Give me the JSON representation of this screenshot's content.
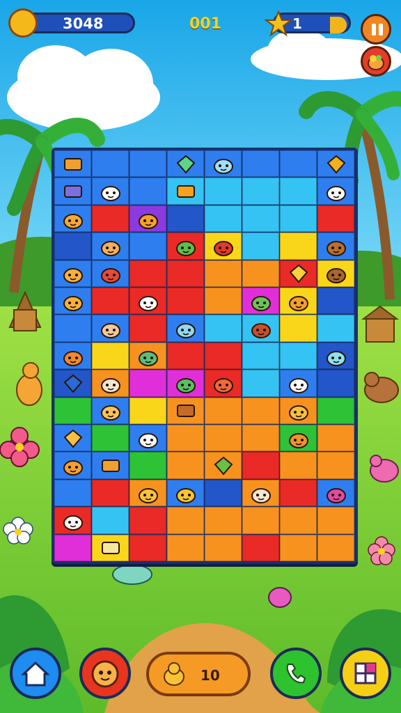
{
  "hud": {
    "coins": "3048",
    "level": "001",
    "lives": "1"
  },
  "bottom_bar": {
    "center_count": "10"
  },
  "board": {
    "rows": 15,
    "cols": 8,
    "cells": [
      [
        "blue",
        "blue",
        "blue",
        "blue",
        "blue",
        "blue",
        "blue",
        "blue"
      ],
      [
        "blue",
        "blue",
        "blue",
        "sky",
        "sky",
        "sky",
        "sky",
        "blue"
      ],
      [
        "blue",
        "red",
        "purple",
        "navy",
        "sky",
        "sky",
        "sky",
        "red"
      ],
      [
        "navy",
        "blue",
        "blue",
        "red",
        "yellow",
        "sky",
        "yellow",
        "blue"
      ],
      [
        "blue",
        "blue",
        "red",
        "red",
        "orange",
        "orange",
        "red",
        "yellow"
      ],
      [
        "blue",
        "red",
        "red",
        "red",
        "orange",
        "magenta",
        "yellow",
        "navy"
      ],
      [
        "blue",
        "blue",
        "red",
        "blue",
        "sky",
        "sky",
        "yellow",
        "sky"
      ],
      [
        "blue",
        "yellow",
        "orange",
        "red",
        "red",
        "sky",
        "sky",
        "navy"
      ],
      [
        "navy",
        "orange",
        "magenta",
        "magenta",
        "red",
        "sky",
        "blue",
        "navy"
      ],
      [
        "green",
        "blue",
        "yellow",
        "orange",
        "orange",
        "orange",
        "orange",
        "green"
      ],
      [
        "blue",
        "green",
        "blue",
        "orange",
        "orange",
        "orange",
        "green",
        "orange"
      ],
      [
        "blue",
        "blue",
        "green",
        "orange",
        "orange",
        "red",
        "orange",
        "orange"
      ],
      [
        "blue",
        "red",
        "orange",
        "blue",
        "navy",
        "orange",
        "red",
        "blue"
      ],
      [
        "red",
        "sky",
        "red",
        "orange",
        "orange",
        "orange",
        "orange",
        "orange"
      ],
      [
        "magenta",
        "yellow",
        "red",
        "orange",
        "orange",
        "red",
        "orange",
        "orange"
      ]
    ],
    "pieces": [
      {
        "r": 0,
        "c": 0,
        "kind": "block",
        "color": "#f0a030"
      },
      {
        "r": 0,
        "c": 3,
        "kind": "gem",
        "color": "#5cd68a"
      },
      {
        "r": 0,
        "c": 4,
        "kind": "creature",
        "color": "#9ee0ff"
      },
      {
        "r": 0,
        "c": 7,
        "kind": "gem",
        "color": "#f3b21b"
      },
      {
        "r": 1,
        "c": 0,
        "kind": "block",
        "color": "#7a6fe0"
      },
      {
        "r": 1,
        "c": 1,
        "kind": "creature",
        "color": "#ffffff"
      },
      {
        "r": 1,
        "c": 3,
        "kind": "block",
        "color": "#f6a21d"
      },
      {
        "r": 1,
        "c": 7,
        "kind": "creature",
        "color": "#ffffff"
      },
      {
        "r": 2,
        "c": 0,
        "kind": "creature",
        "color": "#f3a83a"
      },
      {
        "r": 2,
        "c": 2,
        "kind": "creature",
        "color": "#f5a02a"
      },
      {
        "r": 3,
        "c": 1,
        "kind": "creature",
        "color": "#f2b060"
      },
      {
        "r": 3,
        "c": 3,
        "kind": "creature",
        "color": "#5ac04a"
      },
      {
        "r": 3,
        "c": 4,
        "kind": "creature",
        "color": "#e23a2a"
      },
      {
        "r": 3,
        "c": 7,
        "kind": "creature",
        "color": "#b9702e"
      },
      {
        "r": 4,
        "c": 0,
        "kind": "creature",
        "color": "#f5b040"
      },
      {
        "r": 4,
        "c": 1,
        "kind": "creature",
        "color": "#e84a3a"
      },
      {
        "r": 4,
        "c": 6,
        "kind": "gem",
        "color": "#f7d23a"
      },
      {
        "r": 4,
        "c": 7,
        "kind": "creature",
        "color": "#a8672e"
      },
      {
        "r": 5,
        "c": 0,
        "kind": "creature",
        "color": "#f5b040"
      },
      {
        "r": 5,
        "c": 2,
        "kind": "creature",
        "color": "#ffffff"
      },
      {
        "r": 5,
        "c": 5,
        "kind": "creature",
        "color": "#6ac35a"
      },
      {
        "r": 5,
        "c": 6,
        "kind": "creature",
        "color": "#f5a028"
      },
      {
        "r": 6,
        "c": 1,
        "kind": "creature",
        "color": "#f3c89a"
      },
      {
        "r": 6,
        "c": 3,
        "kind": "creature",
        "color": "#8ed8f0"
      },
      {
        "r": 6,
        "c": 5,
        "kind": "creature",
        "color": "#c8502a"
      },
      {
        "r": 7,
        "c": 0,
        "kind": "creature",
        "color": "#f08a30"
      },
      {
        "r": 7,
        "c": 2,
        "kind": "creature",
        "color": "#58c07a"
      },
      {
        "r": 7,
        "c": 7,
        "kind": "creature",
        "color": "#8ee0f0"
      },
      {
        "r": 8,
        "c": 0,
        "kind": "gem",
        "color": "#2a6ad8"
      },
      {
        "r": 8,
        "c": 1,
        "kind": "creature",
        "color": "#f5e6d0"
      },
      {
        "r": 8,
        "c": 3,
        "kind": "creature",
        "color": "#58c060"
      },
      {
        "r": 8,
        "c": 4,
        "kind": "creature",
        "color": "#f06a3a"
      },
      {
        "r": 8,
        "c": 6,
        "kind": "creature",
        "color": "#ffffff"
      },
      {
        "r": 9,
        "c": 1,
        "kind": "creature",
        "color": "#f7c35a"
      },
      {
        "r": 9,
        "c": 3,
        "kind": "block",
        "color": "#c56b2a"
      },
      {
        "r": 9,
        "c": 6,
        "kind": "creature",
        "color": "#f7c03a"
      },
      {
        "r": 10,
        "c": 0,
        "kind": "gem",
        "color": "#f5c040"
      },
      {
        "r": 10,
        "c": 2,
        "kind": "creature",
        "color": "#ffffff"
      },
      {
        "r": 10,
        "c": 6,
        "kind": "creature",
        "color": "#f0922a"
      },
      {
        "r": 11,
        "c": 0,
        "kind": "creature",
        "color": "#f5a030"
      },
      {
        "r": 11,
        "c": 1,
        "kind": "block",
        "color": "#f0a030"
      },
      {
        "r": 11,
        "c": 4,
        "kind": "gem",
        "color": "#6ac040"
      },
      {
        "r": 12,
        "c": 2,
        "kind": "creature",
        "color": "#f7c335"
      },
      {
        "r": 12,
        "c": 3,
        "kind": "creature",
        "color": "#f7c335"
      },
      {
        "r": 12,
        "c": 5,
        "kind": "creature",
        "color": "#f5e6d0"
      },
      {
        "r": 12,
        "c": 7,
        "kind": "creature",
        "color": "#e04aa0"
      },
      {
        "r": 13,
        "c": 0,
        "kind": "creature",
        "color": "#ffffff"
      },
      {
        "r": 14,
        "c": 1,
        "kind": "block",
        "color": "#f7e8a0"
      }
    ]
  },
  "palette": {
    "blue": "#2e7ef0",
    "sky": "#35c3f3",
    "navy": "#2356c8",
    "red": "#ea2a26",
    "orange": "#f7921f",
    "yellow": "#f9d619",
    "green": "#2ec236",
    "magenta": "#e02fd8",
    "purple": "#8b3ae0"
  }
}
